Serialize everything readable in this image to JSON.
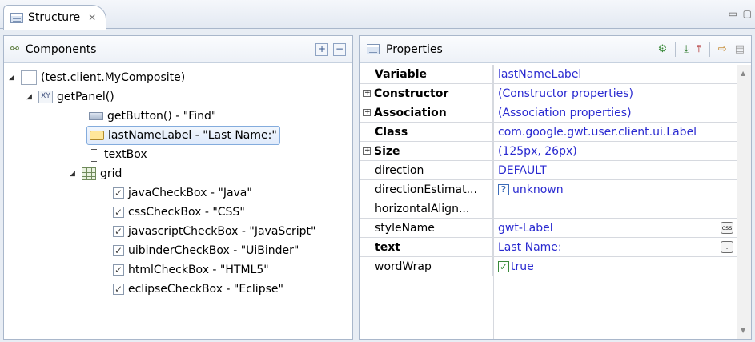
{
  "view_tab": {
    "title": "Structure",
    "close": "✕"
  },
  "components": {
    "title": "Components",
    "expand_all": "+",
    "collapse_all": "−",
    "tree": [
      {
        "label": "(test.client.MyComposite)",
        "icon": "composite-icon",
        "depth": 0,
        "twisty": "◢"
      },
      {
        "label": "getPanel()",
        "icon": "panel-icon",
        "depth": 1,
        "twisty": "◢",
        "icon_text": "XY"
      },
      {
        "label": "getButton() - \"Find\"",
        "icon": "button-icon",
        "depth": 2
      },
      {
        "label": "lastNameLabel - \"Last Name:\"",
        "icon": "label-icon",
        "depth": 2,
        "selected": true
      },
      {
        "label": "textBox",
        "icon": "textbox-icon",
        "depth": 2
      },
      {
        "label": "grid",
        "icon": "grid-icon",
        "depth": 2,
        "twisty": "◢"
      },
      {
        "label": "javaCheckBox - \"Java\"",
        "icon": "checkbox-icon",
        "depth": 3
      },
      {
        "label": "cssCheckBox - \"CSS\"",
        "icon": "checkbox-icon",
        "depth": 3
      },
      {
        "label": "javascriptCheckBox - \"JavaScript\"",
        "icon": "checkbox-icon",
        "depth": 3
      },
      {
        "label": "uibinderCheckBox - \"UiBinder\"",
        "icon": "checkbox-icon",
        "depth": 3
      },
      {
        "label": "htmlCheckBox - \"HTML5\"",
        "icon": "checkbox-icon",
        "depth": 3
      },
      {
        "label": "eclipseCheckBox - \"Eclipse\"",
        "icon": "checkbox-icon",
        "depth": 3
      }
    ]
  },
  "properties": {
    "title": "Properties",
    "rows": [
      {
        "name": "Variable",
        "value": "lastNameLabel",
        "bold": true
      },
      {
        "name": "Constructor",
        "value": "(Constructor properties)",
        "bold": true,
        "expandable": true
      },
      {
        "name": "Association",
        "value": "(Association properties)",
        "bold": true,
        "expandable": true
      },
      {
        "name": "Class",
        "value": "com.google.gwt.user.client.ui.Label",
        "bold": true
      },
      {
        "name": "Size",
        "value": "(125px, 26px)",
        "bold": true,
        "expandable": true
      },
      {
        "name": "direction",
        "value": "DEFAULT"
      },
      {
        "name": "directionEstimat...",
        "value": "unknown",
        "prefix": "?"
      },
      {
        "name": "horizontalAlign...",
        "value": ""
      },
      {
        "name": "styleName",
        "value": "gwt-Label",
        "button": "css"
      },
      {
        "name": "text",
        "value": "Last Name:",
        "bold": true,
        "button": "..."
      },
      {
        "name": "wordWrap",
        "value": "true",
        "check": "✓"
      }
    ]
  }
}
